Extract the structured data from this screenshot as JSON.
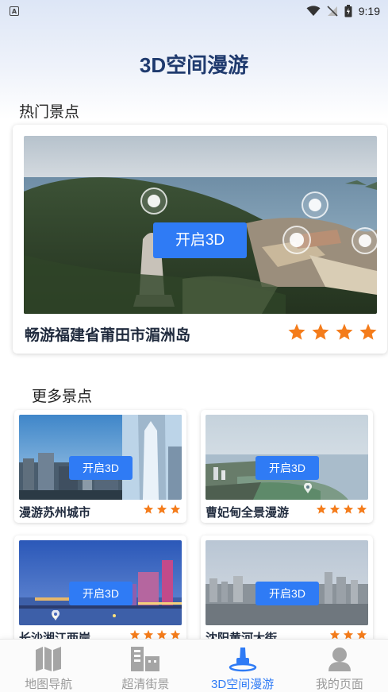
{
  "status_bar": {
    "time": "9:19",
    "notification_icon": "A"
  },
  "header": {
    "title": "3D空间漫游"
  },
  "hot_section": {
    "title": "热门景点",
    "card": {
      "name": "畅游福建省莆田市湄洲岛",
      "button_label": "开启3D",
      "rating": 4,
      "max_rating": 4
    }
  },
  "more_section": {
    "title": "更多景点",
    "cards": [
      {
        "name": "漫游苏州城市",
        "button_label": "开启3D",
        "rating": 3,
        "max_rating": 3
      },
      {
        "name": "曹妃甸全景漫游",
        "button_label": "开启3D",
        "rating": 4,
        "max_rating": 4
      },
      {
        "name": "长沙湘江两岸",
        "button_label": "开启3D",
        "rating": 4,
        "max_rating": 4
      },
      {
        "name": "沈阳黄河大街",
        "button_label": "开启3D",
        "rating": 3,
        "max_rating": 3
      }
    ]
  },
  "bottom_nav": {
    "items": [
      {
        "label": "地图导航",
        "icon": "map-icon",
        "active": false
      },
      {
        "label": "超清街景",
        "icon": "building-icon",
        "active": false
      },
      {
        "label": "3D空间漫游",
        "icon": "roaming-icon",
        "active": true
      },
      {
        "label": "我的页面",
        "icon": "user-icon",
        "active": false
      }
    ]
  },
  "colors": {
    "accent": "#2f7bf5",
    "star": "#f47c1b",
    "title": "#1f3a6e",
    "inactive": "#9a9a9a"
  }
}
